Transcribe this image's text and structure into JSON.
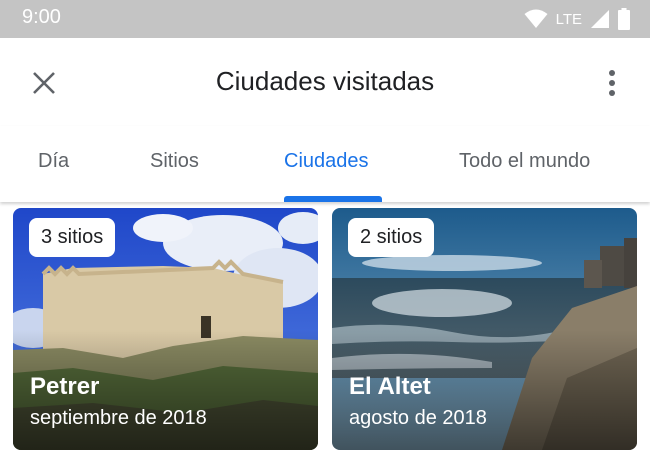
{
  "status_bar": {
    "time": "9:00",
    "network": "LTE",
    "icons": [
      "wifi-icon",
      "signal-icon",
      "battery-icon"
    ]
  },
  "app_bar": {
    "title": "Ciudades visitadas",
    "close_icon": "close-icon",
    "more_icon": "more-vert-icon"
  },
  "tabs": [
    {
      "label": "Día",
      "active": false
    },
    {
      "label": "Sitios",
      "active": false
    },
    {
      "label": "Ciudades",
      "active": true
    },
    {
      "label": "Todo el mundo",
      "active": false
    }
  ],
  "cards": [
    {
      "badge": "3 sitios",
      "title": "Petrer",
      "subtitle": "septiembre de 2018"
    },
    {
      "badge": "2 sitios",
      "title": "El Altet",
      "subtitle": "agosto de 2018"
    }
  ],
  "colors": {
    "accent": "#1a73e8",
    "status_bar": "#c4c4c4",
    "text_primary": "#202124",
    "text_secondary": "#5f6368"
  }
}
